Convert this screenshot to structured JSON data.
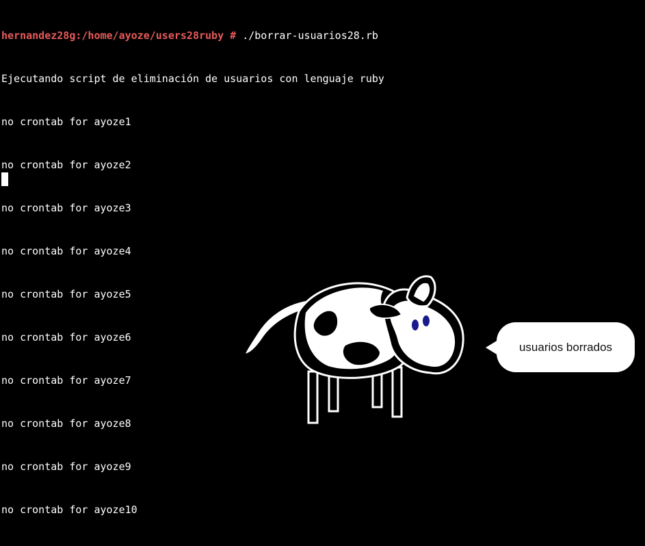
{
  "terminal": {
    "prompt": "hernandez28g:/home/ayoze/users28ruby #",
    "command": " ./borrar-usuarios28.rb",
    "output": [
      "Ejecutando script de eliminación de usuarios con lenguaje ruby",
      "no crontab for ayoze1",
      "no crontab for ayoze2",
      "no crontab for ayoze3",
      "no crontab for ayoze4",
      "no crontab for ayoze5",
      "no crontab for ayoze6",
      "no crontab for ayoze7",
      "no crontab for ayoze8",
      "no crontab for ayoze9",
      "no crontab for ayoze10"
    ]
  },
  "mascot": {
    "icon": "cow-icon",
    "speech": "usuarios borrados"
  },
  "colors": {
    "background": "#000000",
    "text": "#ffffff",
    "prompt": "#e85a5a",
    "cow_eyes": "#1a1a8c"
  }
}
